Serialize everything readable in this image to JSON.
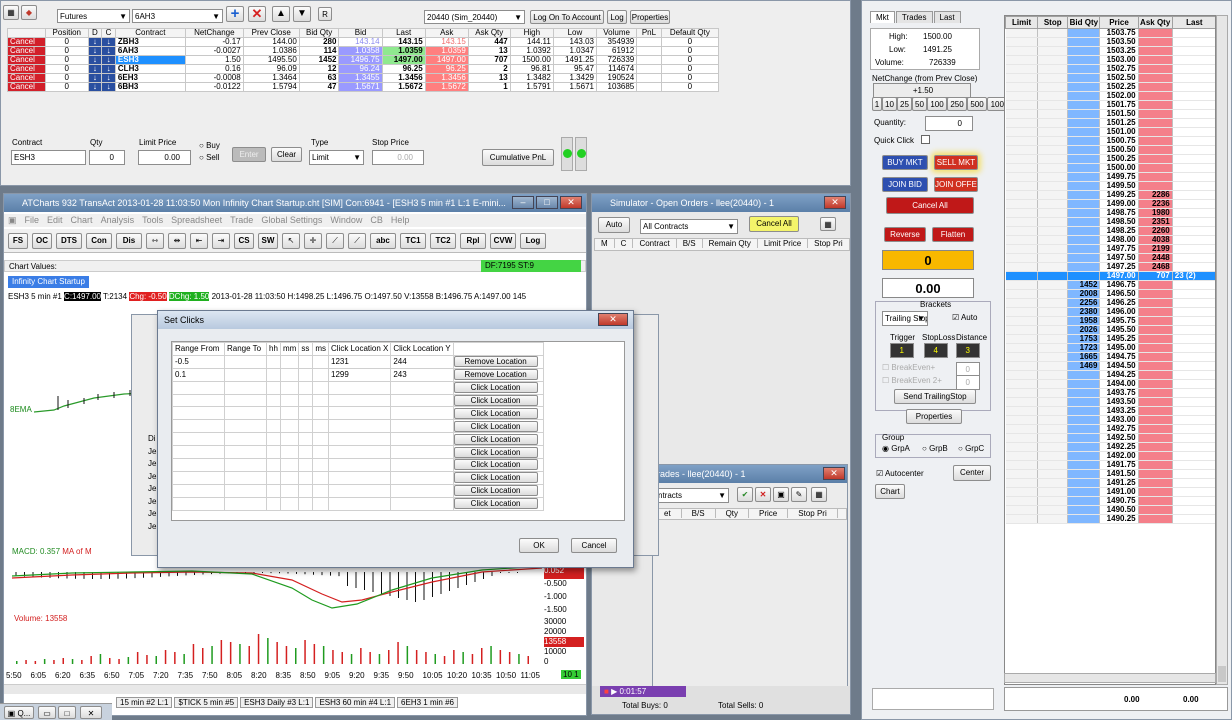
{
  "main_toolbar": {
    "instrument_type": "Futures",
    "d_col": "D",
    "c_col": "C",
    "contract_select": "6AH3",
    "account_select": "20440 (Sim_20440)",
    "log_on_button": "Log On To Account",
    "log_button": "Log",
    "properties_button": "Properties",
    "r_button": "R"
  },
  "quotes": {
    "headers": [
      "Position",
      "D",
      "C",
      "Contract",
      "NetChange",
      "Prev Close",
      "Bid Qty",
      "Bid",
      "Last",
      "Ask",
      "Ask Qty",
      "High",
      "Low",
      "Volume",
      "PnL",
      "Default Qty"
    ],
    "rows": [
      {
        "cancel": "Cancel",
        "position": "0",
        "contract": "ZBH3",
        "netchange": "-0.17",
        "prev": "144.00",
        "bidqty": "280",
        "bid": "143.14",
        "last": "143.15",
        "ask": "143.15",
        "askqty": "447",
        "high": "144.11",
        "low": "143.03",
        "volume": "354939",
        "pnl": "",
        "defqty": "0"
      },
      {
        "cancel": "Cancel",
        "position": "0",
        "contract": "6AH3",
        "netchange": "-0.0027",
        "prev": "1.0386",
        "bidqty": "114",
        "bid": "1.0358",
        "last": "1.0359",
        "ask": "1.0359",
        "askqty": "13",
        "high": "1.0392",
        "low": "1.0347",
        "volume": "61912",
        "pnl": "",
        "defqty": "0"
      },
      {
        "cancel": "Cancel",
        "position": "0",
        "contract": "ESH3",
        "netchange": "1.50",
        "prev": "1495.50",
        "bidqty": "1452",
        "bid": "1496.75",
        "last": "1497.00",
        "ask": "1497.00",
        "askqty": "707",
        "high": "1500.00",
        "low": "1491.25",
        "volume": "726339",
        "pnl": "",
        "defqty": "0"
      },
      {
        "cancel": "Cancel",
        "position": "0",
        "contract": "CLH3",
        "netchange": "0.16",
        "prev": "96.09",
        "bidqty": "12",
        "bid": "96.24",
        "last": "96.25",
        "ask": "96.25",
        "askqty": "2",
        "high": "96.81",
        "low": "95.47",
        "volume": "114674",
        "pnl": "",
        "defqty": "0"
      },
      {
        "cancel": "Cancel",
        "position": "0",
        "contract": "6EH3",
        "netchange": "-0.0008",
        "prev": "1.3464",
        "bidqty": "63",
        "bid": "1.3455",
        "last": "1.3456",
        "ask": "1.3456",
        "askqty": "13",
        "high": "1.3482",
        "low": "1.3429",
        "volume": "190524",
        "pnl": "",
        "defqty": "0"
      },
      {
        "cancel": "Cancel",
        "position": "0",
        "contract": "6BH3",
        "netchange": "-0.0122",
        "prev": "1.5794",
        "bidqty": "47",
        "bid": "1.5671",
        "last": "1.5672",
        "ask": "1.5672",
        "askqty": "1",
        "high": "1.5791",
        "low": "1.5671",
        "volume": "103685",
        "pnl": "",
        "defqty": "0"
      }
    ]
  },
  "order_entry": {
    "contract_label": "Contract",
    "contract_value": "ESH3",
    "qty_label": "Qty",
    "qty_value": "0",
    "limit_label": "Limit Price",
    "limit_value": "0.00",
    "buy_label": "Buy",
    "sell_label": "Sell",
    "enter_button": "Enter",
    "clear_button": "Clear",
    "type_label": "Type",
    "type_value": "Limit",
    "stop_label": "Stop Price",
    "stop_value": "0.00",
    "cumulative_button": "Cumulative PnL"
  },
  "chart_window": {
    "title": "ATCharts 932 TransAct 2013-01-28 11:03:50 Mon  Infinity Chart Startup.cht [SIM] Con:6941 - [ESH3  5 min  #1  L:1  E-mini...",
    "menu": [
      "File",
      "Edit",
      "Chart",
      "Analysis",
      "Tools",
      "Spreadsheet",
      "Trade",
      "Global Settings",
      "Window",
      "CB",
      "Help"
    ],
    "toolbar": [
      "FS",
      "OC",
      "DTS",
      "Con",
      "Dis",
      "CS",
      "SW",
      "abc",
      "TC1",
      "TC2",
      "Rpl",
      "CVW",
      "Log"
    ],
    "chart_values_label": "Chart Values:",
    "df_badge": "DF:7195  ST:9",
    "startup_tab": "Infinity Chart Startup",
    "info_line": {
      "symbol": "ESH3  5 min  #1",
      "c": "C:1497.00",
      "t": "T:2134",
      "chg": "Chg: -0.50",
      "dchg": "DChg: 1.50",
      "rest": "2013-01-28 11:03:50 H:1498.25 L:1496.75 O:1497.50 V:13558 B:1496.75 A:1497.00 145"
    },
    "ema_label": "8EMA",
    "macd_label": "MACD:",
    "macd_value": "MACD: 0.357",
    "macd_ma": "MA of M",
    "macd_axis": [
      "0.052",
      "-0.500",
      "-1.000",
      "-1.500"
    ],
    "volume_label": "Volume:",
    "volume_value": "Volume: 13558",
    "vol_axis": [
      "30000",
      "20000",
      "13558",
      "10000",
      "0"
    ],
    "time_axis": [
      "5:50",
      "6:05",
      "6:20",
      "6:35",
      "6:50",
      "7:05",
      "7:20",
      "7:35",
      "7:50",
      "8:05",
      "8:20",
      "8:35",
      "8:50",
      "9:05",
      "9:20",
      "9:35",
      "9:50",
      "10:05",
      "10:20",
      "10:35",
      "10:50",
      "11:05"
    ],
    "bottom_tabs": [
      "15 min  #2  L:1",
      "$TICK 5 min  #5",
      "ESH3 Daily  #3  L:1",
      "ESH3 60 min  #4  L:1",
      "6EH3 1 min  #6"
    ],
    "page_label": "10 1"
  },
  "set_clicks": {
    "title": "Set Clicks",
    "headers": [
      "Range From",
      "Range To",
      "hh",
      "mm",
      "ss",
      "ms",
      "Click Location X",
      "Click Location Y",
      ""
    ],
    "rows": [
      {
        "from": "-0.5",
        "x": "1231",
        "y": "244",
        "action": "Remove Location"
      },
      {
        "from": "0.1",
        "x": "1299",
        "y": "243",
        "action": "Remove Location"
      },
      {
        "action": "Click Location"
      },
      {
        "action": "Click Location"
      },
      {
        "action": "Click Location"
      },
      {
        "action": "Click Location"
      },
      {
        "action": "Click Location"
      },
      {
        "action": "Click Location"
      },
      {
        "action": "Click Location"
      },
      {
        "action": "Click Location"
      },
      {
        "action": "Click Location"
      },
      {
        "action": "Click Location"
      }
    ],
    "ok_button": "OK",
    "cancel_button": "Cancel",
    "behind_labels": [
      "Di",
      "Je",
      "Je",
      "Je",
      "Je",
      "Je",
      "Je",
      "Je"
    ]
  },
  "sim_orders": {
    "title": "Simulator - Open Orders - llee(20440) - 1",
    "auto_button": "Auto",
    "filter_value": "All Contracts",
    "cancel_all_button": "Cancel All",
    "headers": [
      "M",
      "C",
      "Contract",
      "B/S",
      "Remain Qty",
      "Limit Price",
      "Stop Pri"
    ]
  },
  "trades_window": {
    "title": "rades - llee(20440) - 1",
    "filter_value": "ntracts",
    "headers": [
      "et",
      "B/S",
      "Qty",
      "Price",
      "Stop Pri"
    ]
  },
  "status_bar": {
    "timer": "0:01:57",
    "total_buys": "Total Buys: 0",
    "total_sells": "Total Sells: 0"
  },
  "taskbar": {
    "item": "Q..."
  },
  "dom_panel": {
    "tabs": [
      "Mkt",
      "Trades",
      "Last"
    ],
    "high_label": "High:",
    "high_value": "1500.00",
    "low_label": "Low:",
    "low_value": "1491.25",
    "volume_label": "Volume:",
    "volume_value": "726339",
    "netchange_label": "NetChange (from Prev Close)",
    "netchange_value": "+1.50",
    "qty_buttons": [
      "1",
      "10",
      "25",
      "50",
      "100",
      "250",
      "500",
      "1000"
    ],
    "quantity_label": "Quantity:",
    "quantity_value": "0",
    "quick_click_label": "Quick Click",
    "buy_mkt": "BUY MKT",
    "sell_mkt": "SELL MKT",
    "join_bid": "JOIN BID",
    "join_offer": "JOIN OFFER",
    "cancel_all": "Cancel All",
    "reverse": "Reverse",
    "flatten": "Flatten",
    "position_value": "0",
    "pnl_value": "0.00",
    "brackets_label": "Brackets",
    "trailing_stop": "Trailing Stop",
    "auto_label": "Auto",
    "trigger_label": "Trigger",
    "stoploss_label": "StopLoss",
    "distance_label": "Distance",
    "trigger_value": "1",
    "stoploss_value": "4",
    "distance_value": "3",
    "breakeven1": "BreakEven+",
    "breakeven2": "BreakEven 2+",
    "be1_value": "0",
    "be2_value": "0",
    "send_trailing": "Send TrailingStop",
    "properties": "Properties",
    "group_label": "Group",
    "grp_a": "GrpA",
    "grp_b": "GrpB",
    "grp_c": "GrpC",
    "autocenter_label": "Autocenter",
    "center_button": "Center",
    "chart_button": "Chart",
    "ladder_headers": [
      "Limit",
      "Stop",
      "Bid Qty",
      "Price",
      "Ask Qty",
      "Last"
    ],
    "ladder": [
      [
        "",
        "1503.75",
        ""
      ],
      [
        "",
        "1503.50",
        ""
      ],
      [
        "",
        "1503.25",
        ""
      ],
      [
        "",
        "1503.00",
        ""
      ],
      [
        "",
        "1502.75",
        ""
      ],
      [
        "",
        "1502.50",
        ""
      ],
      [
        "",
        "1502.25",
        ""
      ],
      [
        "",
        "1502.00",
        ""
      ],
      [
        "",
        "1501.75",
        ""
      ],
      [
        "",
        "1501.50",
        ""
      ],
      [
        "",
        "1501.25",
        ""
      ],
      [
        "",
        "1501.00",
        ""
      ],
      [
        "",
        "1500.75",
        ""
      ],
      [
        "",
        "1500.50",
        ""
      ],
      [
        "",
        "1500.25",
        ""
      ],
      [
        "",
        "1500.00",
        ""
      ],
      [
        "",
        "1499.75",
        ""
      ],
      [
        "",
        "1499.50",
        ""
      ],
      [
        "",
        "1499.25",
        "2286"
      ],
      [
        "",
        "1499.00",
        "2236"
      ],
      [
        "",
        "1498.75",
        "1980"
      ],
      [
        "",
        "1498.50",
        "2351"
      ],
      [
        "",
        "1498.25",
        "2260"
      ],
      [
        "",
        "1498.00",
        "4038"
      ],
      [
        "",
        "1497.75",
        "2199"
      ],
      [
        "",
        "1497.50",
        "2448"
      ],
      [
        "",
        "1497.25",
        "2468"
      ],
      [
        "",
        "1497.00",
        "707"
      ],
      [
        "1452",
        "1496.75",
        ""
      ],
      [
        "2008",
        "1496.50",
        ""
      ],
      [
        "2256",
        "1496.25",
        ""
      ],
      [
        "2380",
        "1496.00",
        ""
      ],
      [
        "1958",
        "1495.75",
        ""
      ],
      [
        "2026",
        "1495.50",
        ""
      ],
      [
        "1753",
        "1495.25",
        ""
      ],
      [
        "1723",
        "1495.00",
        ""
      ],
      [
        "1665",
        "1494.75",
        ""
      ],
      [
        "1469",
        "1494.50",
        ""
      ],
      [
        "",
        "1494.25",
        ""
      ],
      [
        "",
        "1494.00",
        ""
      ],
      [
        "",
        "1493.75",
        ""
      ],
      [
        "",
        "1493.50",
        ""
      ],
      [
        "",
        "1493.25",
        ""
      ],
      [
        "",
        "1493.00",
        ""
      ],
      [
        "",
        "1492.75",
        ""
      ],
      [
        "",
        "1492.50",
        ""
      ],
      [
        "",
        "1492.25",
        ""
      ],
      [
        "",
        "1492.00",
        ""
      ],
      [
        "",
        "1491.75",
        ""
      ],
      [
        "",
        "1491.50",
        ""
      ],
      [
        "",
        "1491.25",
        ""
      ],
      [
        "",
        "1491.00",
        ""
      ],
      [
        "",
        "1490.75",
        ""
      ],
      [
        "",
        "1490.50",
        ""
      ],
      [
        "",
        "1490.25",
        ""
      ]
    ],
    "last_marker": "23 (2)",
    "footer_left": "0.00",
    "footer_right": "0.00"
  }
}
